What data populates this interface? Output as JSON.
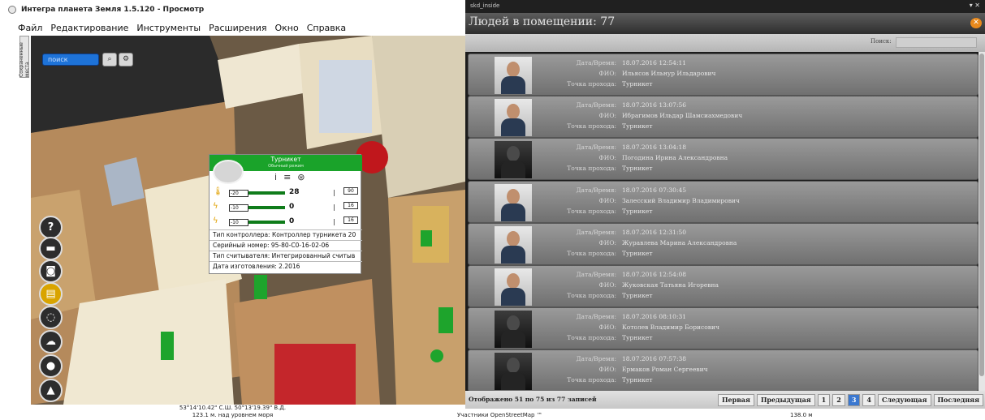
{
  "left_app": {
    "title": "Интегра планета Земля 1.5.120 - Просмотр",
    "menu": [
      "Файл",
      "Редактирование",
      "Инструменты",
      "Расширения",
      "Окно",
      "Справка"
    ],
    "side_tab": "Сохраненные места",
    "search_placeholder": "поиск",
    "tool_icons": [
      "help-icon",
      "layers-icon",
      "camera-icon",
      "folder-icon",
      "rotate-icon",
      "cloud-icon",
      "chat-icon",
      "landscape-icon"
    ],
    "popup": {
      "title": "Турникет",
      "subtitle": "Обычный режим",
      "rows": [
        {
          "icon": "temperature-icon",
          "min": "-20",
          "value": "28",
          "max": "90"
        },
        {
          "icon": "voltage-icon",
          "min": "-10",
          "value": "0",
          "max": "16"
        },
        {
          "icon": "voltage-icon",
          "min": "-10",
          "value": "0",
          "max": "16"
        }
      ],
      "details": [
        "Тип контроллера: Контроллер турникета 20",
        "Серийный номер: 95-80-C0-16-02-06",
        "Тип считывателя: Интегрированный считыв",
        "Дата изготовления: 2.2016"
      ]
    },
    "status": {
      "coords": "53°14'10.42\" С.Ш. 50°13'19.39\" В.Д.",
      "altitude": "123.1 м. над уровнем моря"
    }
  },
  "right_app": {
    "window_title": "skd_inside",
    "header": "Людей в помещении: 77",
    "search_label": "Поиск:",
    "field_labels": {
      "datetime": "Дата/Время:",
      "fio": "ФИО:",
      "point": "Точка прохода:"
    },
    "entries": [
      {
        "datetime": "18.07.2016 12:54:11",
        "fio": "Ильясов Ильнур Ильдарович",
        "point": "Турникет",
        "dark": false
      },
      {
        "datetime": "18.07.2016 13:07:56",
        "fio": "Ибрагимов Ильдар Шамсиахмедович",
        "point": "Турникет",
        "dark": false
      },
      {
        "datetime": "18.07.2016 13:04:18",
        "fio": "Погодина Ирина Александровна",
        "point": "Турникет",
        "dark": true
      },
      {
        "datetime": "18.07.2016 07:30:45",
        "fio": "Залесский Владимир Владимирович",
        "point": "Турникет",
        "dark": false
      },
      {
        "datetime": "18.07.2016 12:31:50",
        "fio": "Журавлева Марина Александровна",
        "point": "Турникет",
        "dark": false
      },
      {
        "datetime": "18.07.2016 12:54:08",
        "fio": "Жуковская Татьяна Игоревна",
        "point": "Турникет",
        "dark": false
      },
      {
        "datetime": "18.07.2016 08:10:31",
        "fio": "Котолев Владимир Борисович",
        "point": "Турникет",
        "dark": true
      },
      {
        "datetime": "18.07.2016 07:57:38",
        "fio": "Ермаков Роман Сергеевич",
        "point": "Турникет",
        "dark": true
      }
    ],
    "footer_info": "Отображено 51 по 75 из 77 записей",
    "pager": [
      "Первая",
      "Предыдущая",
      "1",
      "2",
      "3",
      "4",
      "Следующая",
      "Последняя"
    ],
    "current_page": "3",
    "bottom_attribution": "Участники OpenStreetMap ™",
    "bottom_scale": "138.0 м"
  },
  "colors": {
    "accent_green": "#1aa32a",
    "accent_blue": "#1e73d8",
    "close_orange": "#e8891c"
  }
}
